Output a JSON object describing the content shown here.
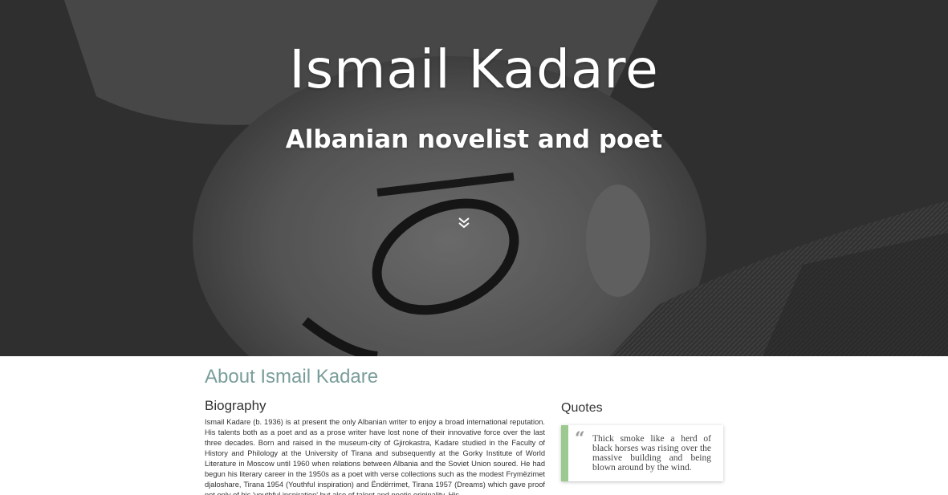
{
  "hero": {
    "title": "Ismail Kadare",
    "subtitle": "Albanian novelist and poet",
    "scroll_icon": "double-chevron-down-icon"
  },
  "about": {
    "title": "About Ismail Kadare",
    "biography_title": "Biography",
    "biography_text": "Ismail Kadare (b. 1936) is at present the only Albanian writer to enjoy a broad international reputation. His talents both as a poet and as a prose writer have lost none of their innovative force over the last three decades. Born and raised in the museum-city of Gjirokastra, Kadare studied in the Faculty of History and Philology at the University of Tirana and subsequently at the Gorky Institute of World Literature in Moscow until 1960 when relations between Albania and the Soviet Union soured. He had begun his literary career in the 1950s as a poet with verse collections such as the modest Frymëzimet djaloshare, Tirana 1954 (Youthful inspiration) and Ëndërrimet, Tirana 1957 (Dreams) which gave proof not only of his 'youthful inspiration' but also of talent and poetic originality. His"
  },
  "quotes": {
    "title": "Quotes",
    "quote_mark": "“",
    "quote_text": "Thick smoke like a herd of black horses was rising over the massive building and being blown around by the wind.",
    "accent_color": "#9cc98f"
  },
  "colors": {
    "about_title": "#7a9e9a"
  }
}
